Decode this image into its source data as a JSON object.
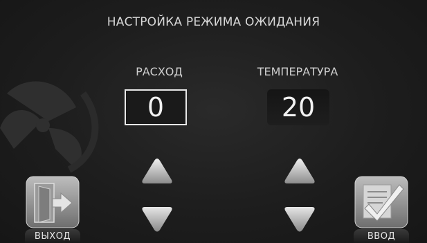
{
  "title": "НАСТРОЙКА РЕЖИМА ОЖИДАНИЯ",
  "flow": {
    "label": "РАСХОД",
    "value": "0"
  },
  "temperature": {
    "label": "ТЕМПЕРАТУРА",
    "value": "20"
  },
  "buttons": {
    "exit_label": "ВЫХОД",
    "enter_label": "ВВОД"
  },
  "icons": {
    "flow_up": "triangle-up-icon",
    "flow_down": "triangle-down-icon",
    "temp_up": "triangle-up-icon",
    "temp_down": "triangle-down-icon",
    "exit": "door-exit-icon",
    "enter": "checkmark-document-icon",
    "background": "fan-logo-icon"
  },
  "colors": {
    "background": "#1c1c1c",
    "text": "#d8d8d8",
    "selection_border": "#e8e8e8"
  }
}
